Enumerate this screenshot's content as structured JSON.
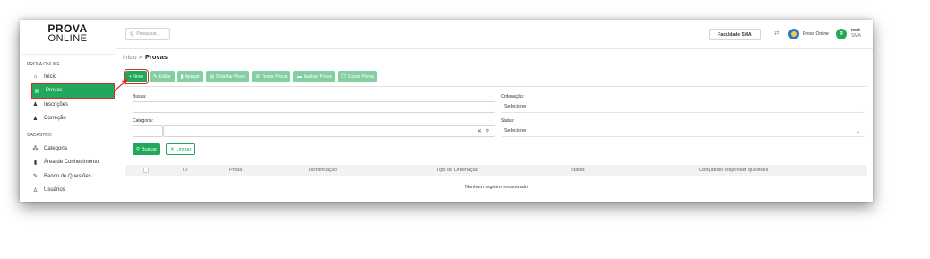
{
  "logo": {
    "line1": "PROVA",
    "line2": "ONLINE"
  },
  "sidebar": {
    "section1": "PROVA ONLINE",
    "items1": [
      {
        "label": "Início",
        "icon": "home-icon"
      },
      {
        "label": "Provas",
        "icon": "document-icon",
        "active": true
      },
      {
        "label": "Inscrições",
        "icon": "users-icon"
      },
      {
        "label": "Correção",
        "icon": "user-check-icon"
      }
    ],
    "section2": "CADASTRO",
    "items2": [
      {
        "label": "Categoria",
        "icon": "sitemap-icon"
      },
      {
        "label": "Área de Conhecimento",
        "icon": "book-icon"
      },
      {
        "label": "Banco de Questões",
        "icon": "pencil-icon"
      },
      {
        "label": "Usuários",
        "icon": "user-icon"
      }
    ]
  },
  "topbar": {
    "search_placeholder": "Pesquisar...",
    "faculty": "Faculdade SMA",
    "app_name": "Prova Online",
    "avatar_initial": "R",
    "user_name": "root",
    "user_sub": "SMA"
  },
  "breadcrumb": {
    "home": "Início",
    "sep": ">",
    "current": "Provas"
  },
  "toolbar": {
    "new": "+ Novo",
    "edit": "Editar",
    "delete": "Apagar",
    "detail": "Detalhar Prova",
    "test": "Testar Prova",
    "inactivate": "Inativar Prova",
    "copy": "Copiar Prova"
  },
  "filters": {
    "busca_label": "Busca:",
    "busca_value": "",
    "ordenacao_label": "Ordenação:",
    "ordenacao_value": "Selecione",
    "categoria_label": "Categoria:",
    "categoria_value": "",
    "status_label": "Status:",
    "status_value": "Selecione",
    "search_button": "Buscar",
    "clear_button": "Limpar"
  },
  "table": {
    "columns": [
      "ID",
      "Prova",
      "Identificação",
      "Tipo de Ordenação",
      "Status",
      "Obrigatório responder questões"
    ],
    "empty_message": "Nenhum registro encontrado"
  },
  "colors": {
    "accent": "#22a85a",
    "highlight": "#d23030"
  }
}
